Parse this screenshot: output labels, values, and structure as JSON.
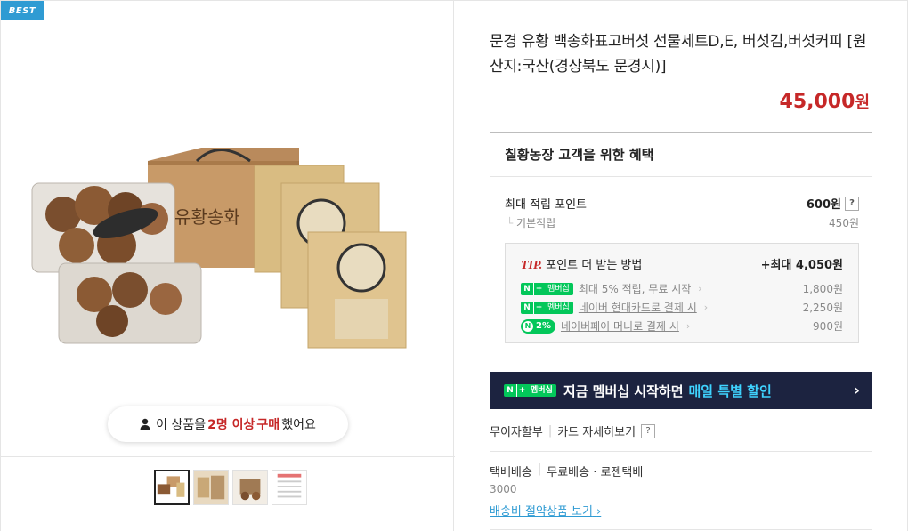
{
  "badge": "BEST",
  "purchase": {
    "prefix": "이 상품을",
    "count": "2명 이상",
    "mid": "구매",
    "suffix": "했어요"
  },
  "product": {
    "title": "문경 유황 백송화표고버섯 선물세트D,E, 버섯김,버섯커피 [원산지:국산(경상북도 문경시)]",
    "price": "45,000",
    "price_unit": "원"
  },
  "benefit": {
    "heading": "칠황농장 고객을 위한 혜택",
    "max_label": "최대 적립 포인트",
    "max_value": "600원",
    "base_label": "기본적립",
    "base_value": "450원",
    "tip_label": "TIP.",
    "tip_text": "포인트 더 받는 방법",
    "tip_max": "+최대 4,050원",
    "rows": [
      {
        "badge": "멤버십",
        "text": "최대 5% 적립, 무료 시작",
        "value": "1,800원"
      },
      {
        "badge": "멤버십",
        "text": "네이버 현대카드로 결제 시",
        "value": "2,250원"
      },
      {
        "badge": "2%",
        "text": "네이버페이 머니로 결제 시",
        "value": "900원"
      }
    ]
  },
  "member_banner": {
    "badge": "멤버십",
    "text": "지금 멤버십 시작하면",
    "accent": "매일 특별 할인"
  },
  "card": {
    "installment": "무이자할부",
    "detail": "카드 자세히보기"
  },
  "shipping": {
    "type": "택배배송",
    "detail": "무료배송 · 로젠택배",
    "fee": "3000",
    "link": "배송비 절약상품 보기"
  },
  "colors": {
    "accent_red": "#c62828",
    "naver_green": "#03c75a",
    "banner_navy": "#1c2340",
    "best_blue": "#2f9bd3"
  }
}
